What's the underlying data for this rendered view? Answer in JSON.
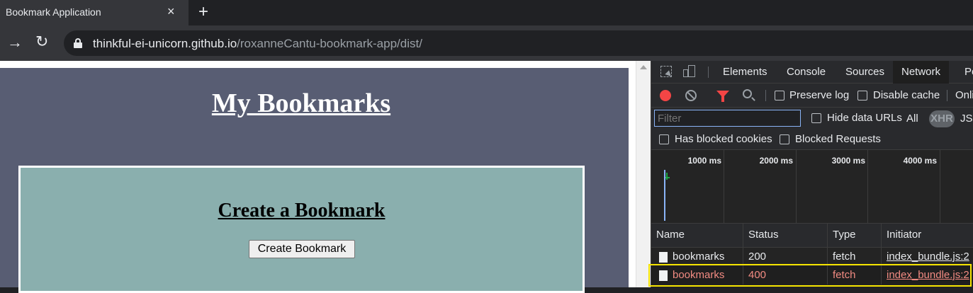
{
  "browser": {
    "tab": {
      "title": "Bookmark Application",
      "close_icon": "×",
      "new_tab_icon": "+"
    },
    "nav": {
      "forward_icon": "→",
      "reload_icon": "↻"
    },
    "url": {
      "host": "thinkful-ei-unicorn.github.io",
      "path": "/roxanneCantu-bookmark-app/dist/"
    }
  },
  "page": {
    "title": "My Bookmarks",
    "section_title": "Create a Bookmark",
    "create_button": "Create Bookmark",
    "colors": {
      "background": "#585d73",
      "panel": "#8aafae"
    }
  },
  "devtools": {
    "tabs": [
      "Elements",
      "Console",
      "Sources",
      "Network",
      "Pe"
    ],
    "active_tab": "Network",
    "toolbar": {
      "preserve_log": "Preserve log",
      "disable_cache": "Disable cache",
      "online": "Onli"
    },
    "filter": {
      "placeholder": "Filter",
      "hide_data_urls": "Hide data URLs",
      "all": "All",
      "xhr": "XHR",
      "js": "JS"
    },
    "blocked": {
      "has_blocked_cookies": "Has blocked cookies",
      "blocked_requests": "Blocked Requests"
    },
    "timeline": {
      "ticks": [
        "1000 ms",
        "2000 ms",
        "3000 ms",
        "4000 ms"
      ]
    },
    "table": {
      "headers": {
        "name": "Name",
        "status": "Status",
        "type": "Type",
        "initiator": "Initiator"
      },
      "rows": [
        {
          "name": "bookmarks",
          "status": "200",
          "type": "fetch",
          "initiator": "index_bundle.js:2"
        },
        {
          "name": "bookmarks",
          "status": "400",
          "type": "fetch",
          "initiator": "index_bundle.js:2"
        }
      ]
    },
    "colors": {
      "error_text": "#f28b82",
      "highlight": "#f5e400",
      "record": "#f44545"
    }
  }
}
